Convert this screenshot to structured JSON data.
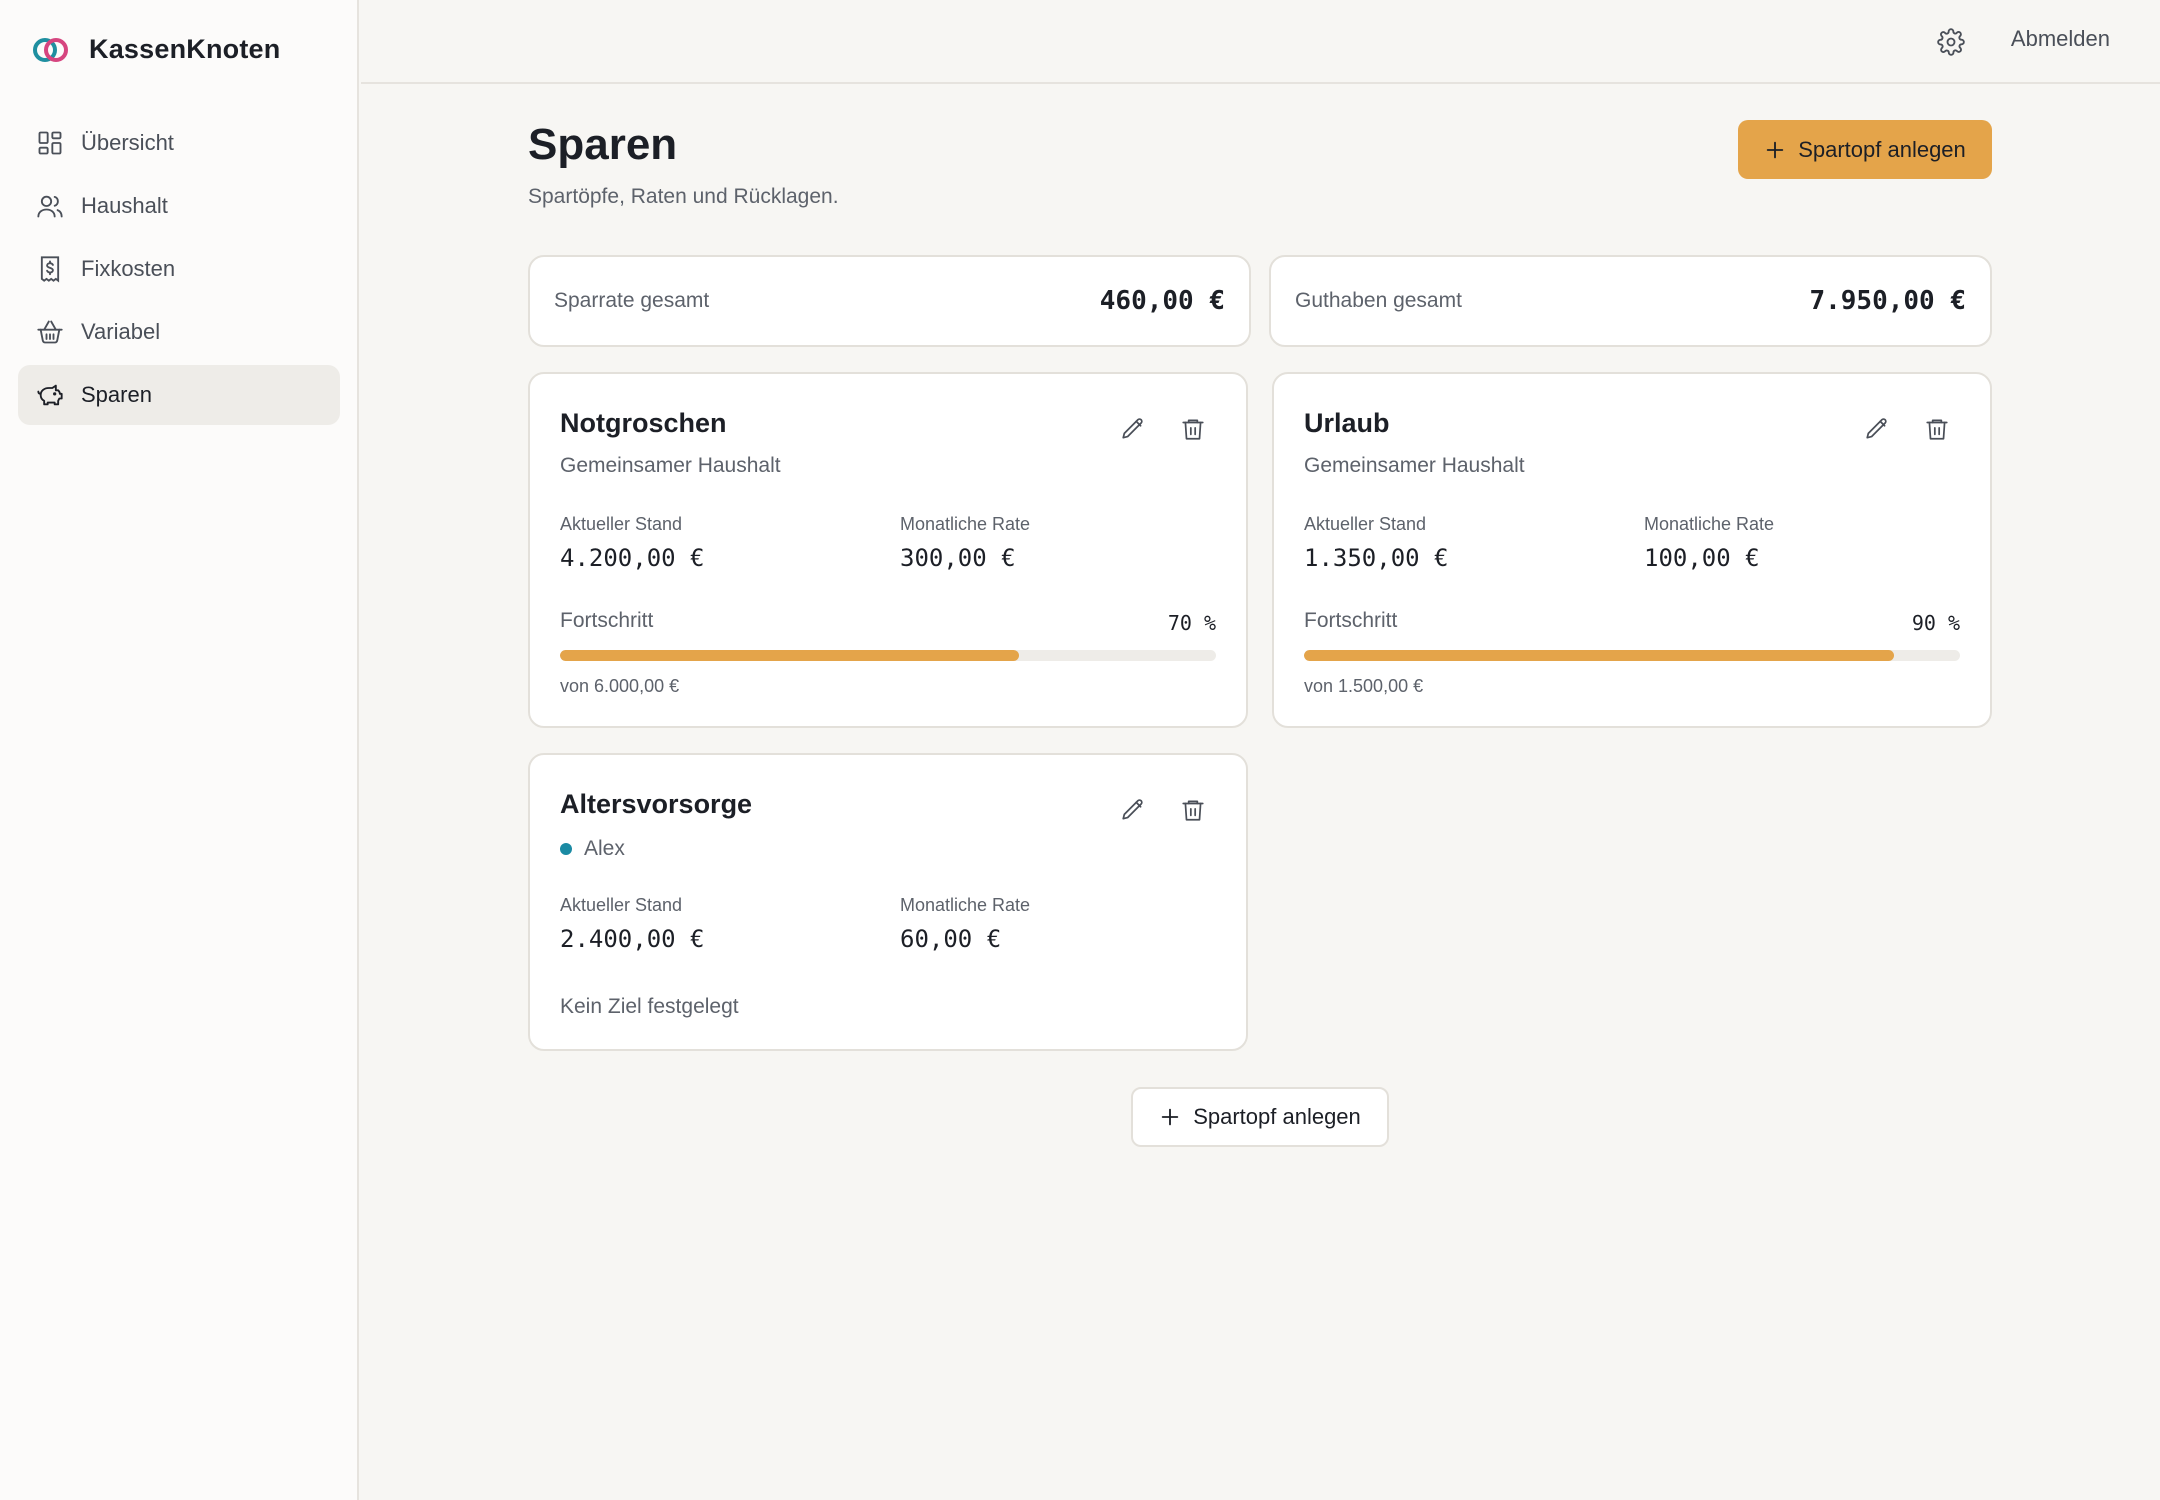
{
  "app": {
    "name": "KassenKnoten"
  },
  "sidebar": {
    "items": [
      {
        "label": "Übersicht",
        "icon": "dashboard-grid-icon",
        "active": false
      },
      {
        "label": "Haushalt",
        "icon": "users-icon",
        "active": false
      },
      {
        "label": "Fixkosten",
        "icon": "receipt-icon",
        "active": false
      },
      {
        "label": "Variabel",
        "icon": "basket-icon",
        "active": false
      },
      {
        "label": "Sparen",
        "icon": "piggy-bank-icon",
        "active": true
      }
    ]
  },
  "topbar": {
    "settings_icon": "gear-icon",
    "logout_label": "Abmelden"
  },
  "page": {
    "title": "Sparen",
    "subtitle": "Spartöpfe, Raten und Rücklagen.",
    "add_button_label": "Spartopf anlegen"
  },
  "summary": {
    "rate_label": "Sparrate gesamt",
    "rate_value": "460,00 €",
    "balance_label": "Guthaben gesamt",
    "balance_value": "7.950,00 €"
  },
  "pots": [
    {
      "name": "Notgroschen",
      "owner": "Gemeinsamer Haushalt",
      "current_label": "Aktueller Stand",
      "current_value": "4.200,00 €",
      "rate_label": "Monatliche Rate",
      "rate_value": "300,00 €",
      "progress_label": "Fortschritt",
      "progress_percent_text": "70 %",
      "progress": 0.7,
      "target_text": "von 6.000,00 €"
    },
    {
      "name": "Urlaub",
      "owner": "Gemeinsamer Haushalt",
      "current_label": "Aktueller Stand",
      "current_value": "1.350,00 €",
      "rate_label": "Monatliche Rate",
      "rate_value": "100,00 €",
      "progress_label": "Fortschritt",
      "progress_percent_text": "90 %",
      "progress": 0.9,
      "target_text": "von 1.500,00 €"
    },
    {
      "name": "Altersvorsorge",
      "owner": "Alex",
      "owner_color": "#1a8aa3",
      "current_label": "Aktueller Stand",
      "current_value": "2.400,00 €",
      "rate_label": "Monatliche Rate",
      "rate_value": "60,00 €",
      "no_goal_text": "Kein Ziel festgelegt"
    }
  ],
  "bottom": {
    "add_button_label": "Spartopf anlegen"
  },
  "colors": {
    "accent": "#e4a44a",
    "logo_teal": "#1f8fa0",
    "logo_pink": "#d6457f"
  }
}
